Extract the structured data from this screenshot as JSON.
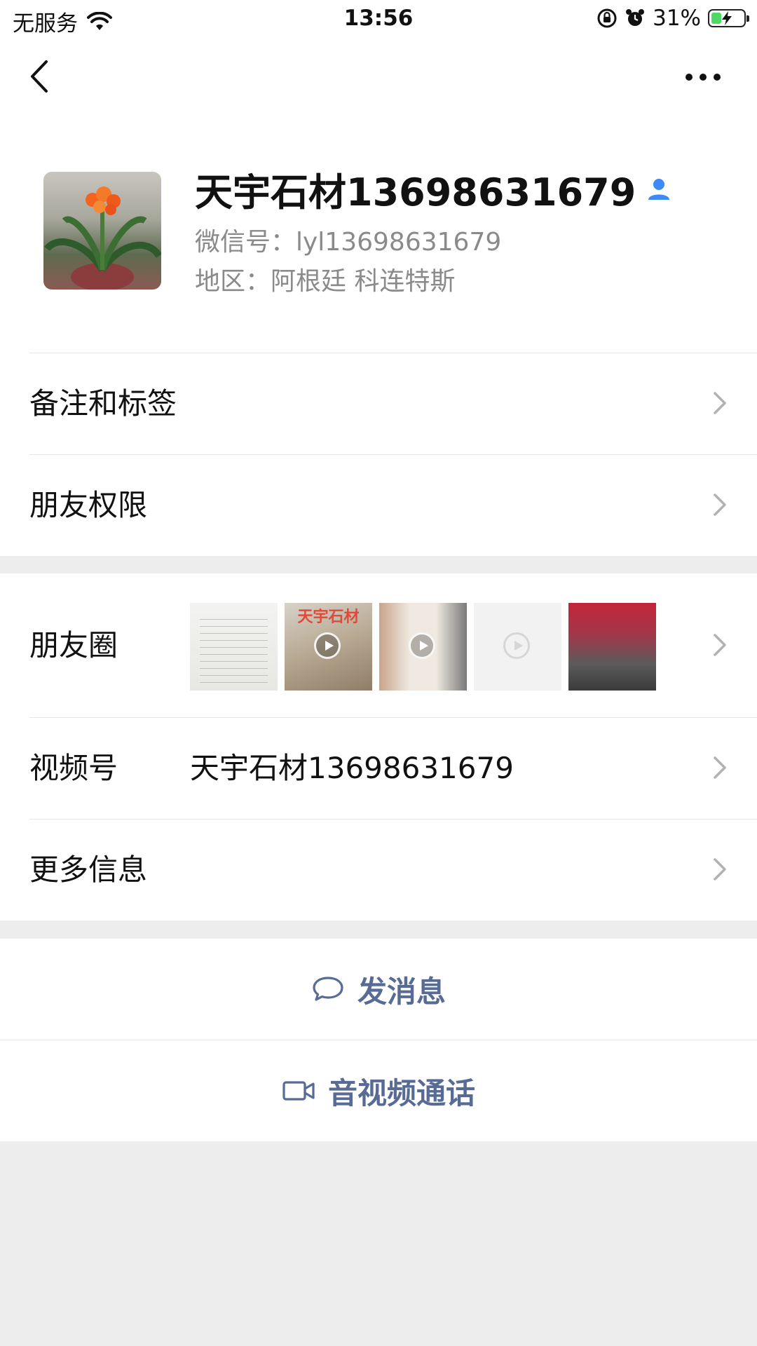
{
  "status_bar": {
    "carrier": "无服务",
    "time": "13:56",
    "battery": "31%",
    "battery_level": 0.31
  },
  "nav": {
    "back_icon": "chevron-left-icon",
    "more_icon": "ellipsis-icon"
  },
  "profile": {
    "name": "天宇石材13698631679",
    "wechat_id": "微信号：lyl13698631679",
    "region": "地区：阿根廷 科连特斯"
  },
  "menu": {
    "remarks_tags": "备注和标签",
    "friend_permissions": "朋友权限",
    "moments": "朋友圈",
    "moments_thumb_text": "天宇石材",
    "channels": "视频号",
    "channels_value": "天宇石材13698631679",
    "more_info": "更多信息"
  },
  "actions": {
    "send_message": "发消息",
    "voice_video_call": "音视频通话"
  },
  "colors": {
    "link_blue": "#576b95",
    "background": "#ededed",
    "badge_blue": "#3d8af7"
  }
}
